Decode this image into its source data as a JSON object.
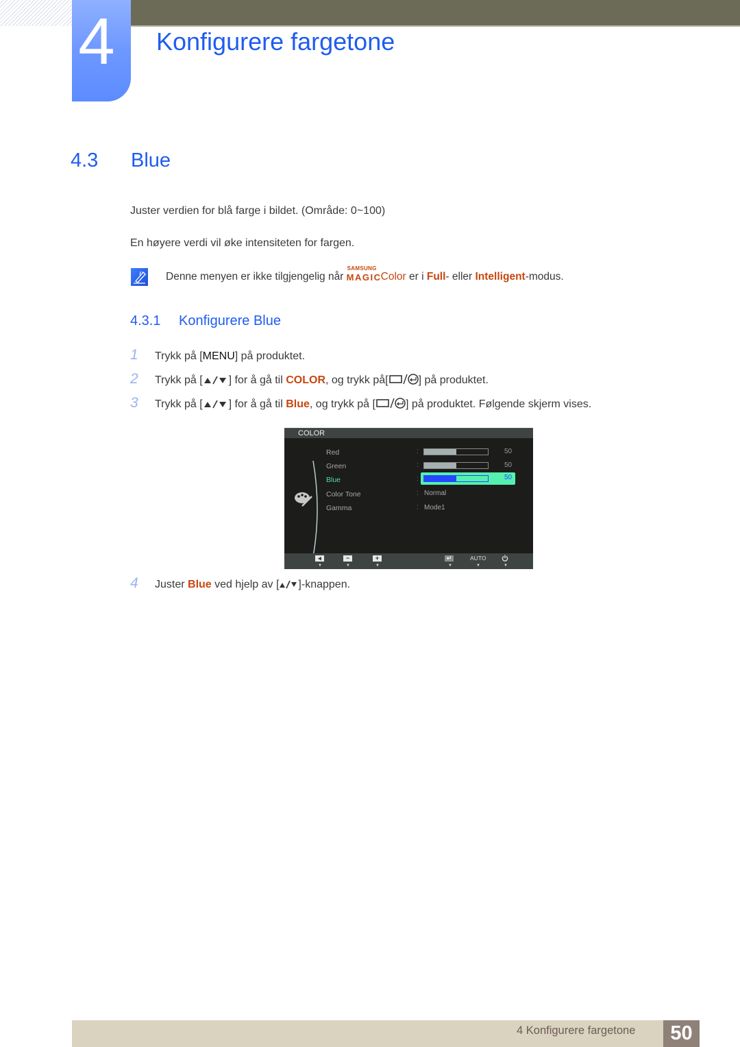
{
  "chapter": {
    "number": "4",
    "title": "Konfigurere fargetone"
  },
  "section": {
    "number": "4.3",
    "title": "Blue"
  },
  "paragraphs": [
    "Juster verdien for blå farge i bildet. (Område: 0~100)",
    "En høyere verdi vil øke intensiteten for fargen."
  ],
  "note": {
    "icon": "note-pencil-icon",
    "before": "Denne menyen er ikke tilgjengelig når ",
    "magic_top": "SAMSUNG",
    "magic_bottom": "MAGIC",
    "magic_color": "Color",
    "mid1": " er i ",
    "full": "Full",
    "mid2": "- eller ",
    "intelligent": "Intelligent",
    "after": "-modus."
  },
  "subsection": {
    "number": "4.3.1",
    "title": "Konfigurere Blue"
  },
  "steps": [
    {
      "n": "1",
      "a": "Trykk på [",
      "key": "MENU",
      "b": "] på produktet."
    },
    {
      "n": "2",
      "a": "Trykk på [",
      "b": "] for å gå til ",
      "hl": "COLOR",
      "c": ", og trykk på[",
      "d": "] på produktet."
    },
    {
      "n": "3",
      "a": "Trykk på [",
      "b": "] for å gå til ",
      "hl": "Blue",
      "c": ", og trykk på [",
      "d": "] på produktet. Følgende skjerm vises."
    },
    {
      "n": "4",
      "a": "Juster ",
      "hl": "Blue",
      "b": " ved hjelp av [",
      "c": "]-knappen."
    }
  ],
  "osd": {
    "title": "COLOR",
    "items": [
      {
        "label": "Red",
        "type": "slider",
        "value": 50
      },
      {
        "label": "Green",
        "type": "slider",
        "value": 50
      },
      {
        "label": "Blue",
        "type": "slider",
        "value": 50,
        "active": true
      },
      {
        "label": "Color Tone",
        "type": "text",
        "value": "Normal"
      },
      {
        "label": "Gamma",
        "type": "text",
        "value": "Mode1"
      }
    ],
    "colon": ":",
    "footer": {
      "auto": "AUTO",
      "arrow": "▼"
    },
    "colors": {
      "active": "#4fe29d",
      "highlight": "#55f0b0",
      "fill_active": "#2548ff"
    }
  },
  "footer": {
    "label": "4 Konfigurere fargetone",
    "page": "50"
  },
  "colors": {
    "heading": "#1f5cf0",
    "highlight": "#c8460f",
    "topbar": "#6c6b57",
    "footer_band": "#d9d3c0",
    "page_badge": "#8f8178"
  }
}
